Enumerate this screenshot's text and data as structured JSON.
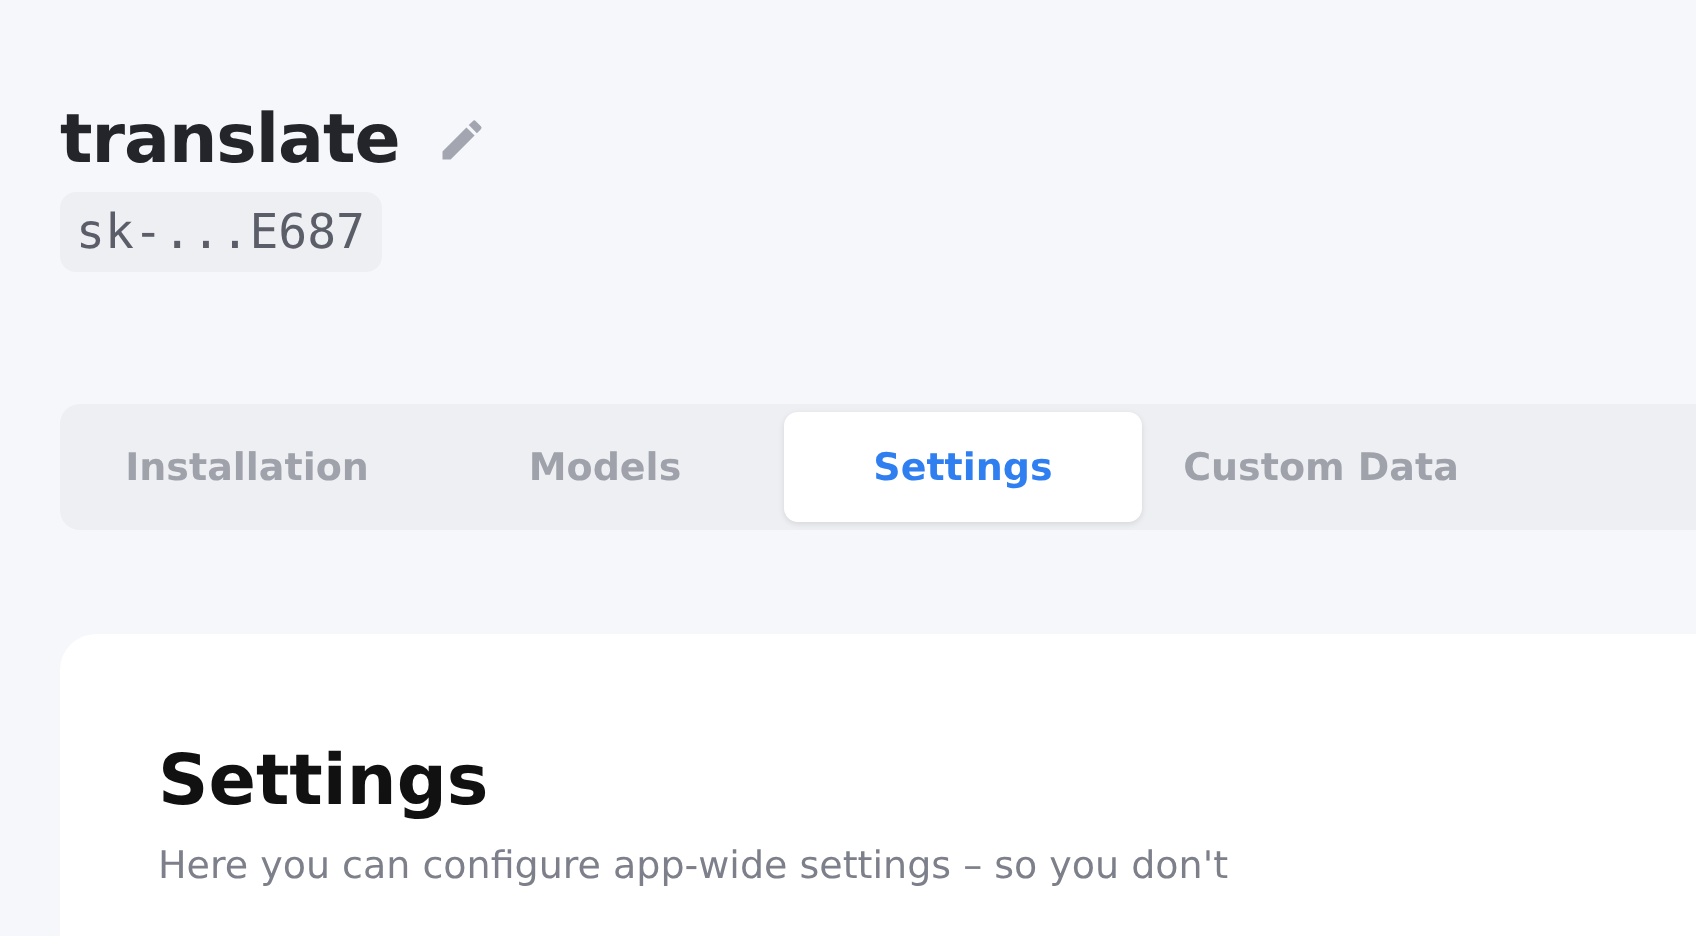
{
  "project": {
    "title": "translate",
    "key": "sk-...E687"
  },
  "tabs": [
    {
      "label": "Installation",
      "selected": false
    },
    {
      "label": "Models",
      "selected": false
    },
    {
      "label": "Settings",
      "selected": true
    },
    {
      "label": "Custom Data",
      "selected": false
    }
  ],
  "settings": {
    "heading": "Settings",
    "description": "Here you can configure app-wide settings – so you don't"
  }
}
